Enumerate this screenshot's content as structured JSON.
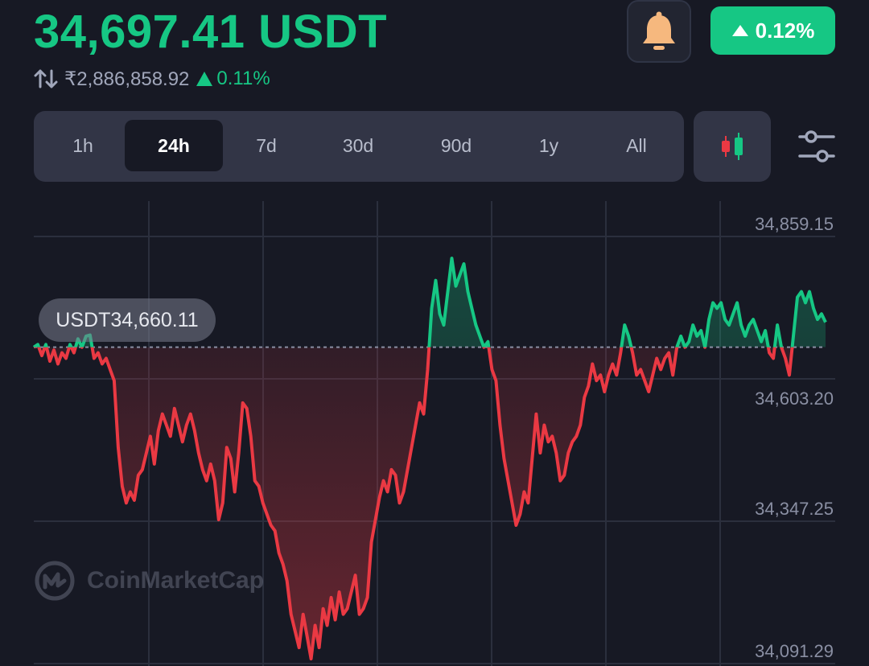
{
  "header": {
    "price": "34,697.41 USDT",
    "inr_price": "₹2,886,858.92",
    "inr_change": "0.11%",
    "change_badge": "0.12%"
  },
  "range_tabs": [
    {
      "label": "1h",
      "active": false
    },
    {
      "label": "24h",
      "active": true
    },
    {
      "label": "7d",
      "active": false
    },
    {
      "label": "30d",
      "active": false
    },
    {
      "label": "90d",
      "active": false
    },
    {
      "label": "1y",
      "active": false
    },
    {
      "label": "All",
      "active": false
    }
  ],
  "icons": {
    "swap": "swap-vertical-icon",
    "bell": "bell-icon",
    "up": "triangle-up-icon",
    "candles": "candlestick-icon",
    "settings": "sliders-icon",
    "logo": "coinmarketcap-logo-icon"
  },
  "colors": {
    "up": "#16c784",
    "down": "#ea3943",
    "background": "#171924",
    "panel": "#323546",
    "bell": "#f6b87e"
  },
  "cursor_label": "USDT34,660.11",
  "watermark": "CoinMarketCap",
  "chart_data": {
    "type": "line",
    "y_ticks": [
      "34,859.15",
      "34,603.20",
      "34,347.25",
      "34,091.29"
    ],
    "ylim": [
      34091.29,
      34859.15
    ],
    "baseline": 34660.11,
    "grid": true,
    "values": [
      34660,
      34665,
      34645,
      34665,
      34635,
      34655,
      34630,
      34650,
      34640,
      34665,
      34650,
      34675,
      34660,
      34680,
      34682,
      34640,
      34650,
      34630,
      34640,
      34620,
      34600,
      34480,
      34410,
      34380,
      34400,
      34385,
      34430,
      34440,
      34470,
      34500,
      34450,
      34510,
      34540,
      34520,
      34500,
      34550,
      34520,
      34490,
      34520,
      34540,
      34510,
      34470,
      34440,
      34420,
      34450,
      34420,
      34350,
      34380,
      34480,
      34460,
      34400,
      34470,
      34560,
      34550,
      34500,
      34420,
      34410,
      34380,
      34360,
      34340,
      34330,
      34290,
      34270,
      34240,
      34180,
      34150,
      34120,
      34180,
      34140,
      34100,
      34160,
      34120,
      34190,
      34160,
      34210,
      34170,
      34220,
      34180,
      34190,
      34220,
      34250,
      34180,
      34190,
      34210,
      34310,
      34350,
      34390,
      34420,
      34400,
      34440,
      34430,
      34380,
      34400,
      34440,
      34480,
      34520,
      34560,
      34540,
      34620,
      34730,
      34780,
      34720,
      34700,
      34760,
      34820,
      34770,
      34790,
      34810,
      34760,
      34730,
      34700,
      34680,
      34660,
      34670,
      34620,
      34600,
      34520,
      34460,
      34420,
      34380,
      34340,
      34360,
      34400,
      34380,
      34460,
      34540,
      34470,
      34520,
      34490,
      34500,
      34470,
      34420,
      34430,
      34470,
      34490,
      34500,
      34520,
      34570,
      34590,
      34630,
      34600,
      34610,
      34580,
      34610,
      34630,
      34610,
      34650,
      34700,
      34680,
      34650,
      34610,
      34620,
      34600,
      34580,
      34610,
      34640,
      34620,
      34640,
      34650,
      34610,
      34660,
      34680,
      34660,
      34670,
      34700,
      34680,
      34690,
      34660,
      34710,
      34740,
      34730,
      34740,
      34710,
      34700,
      34720,
      34740,
      34700,
      34680,
      34700,
      34710,
      34690,
      34670,
      34690,
      34650,
      34640,
      34700,
      34660,
      34640,
      34610,
      34680,
      34750,
      34760,
      34740,
      34760,
      34730,
      34710,
      34720,
      34705
    ],
    "series_colors": {
      "above_baseline": "#16c784",
      "below_baseline": "#ea3943"
    }
  }
}
